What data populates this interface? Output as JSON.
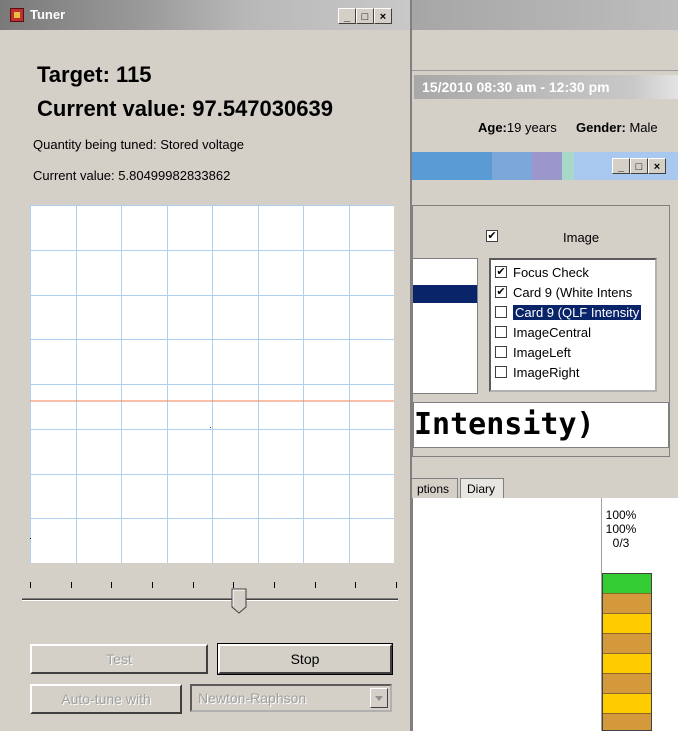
{
  "tuner": {
    "title": "Tuner",
    "target": "Target: 115",
    "current_value_large": "Current value: 97.547030639",
    "quantity": "Quantity being tuned: Stored voltage",
    "current_value_small": "Current value: 5.80499982833862",
    "buttons": {
      "test": "Test",
      "stop": "Stop",
      "autotune": "Auto-tune with"
    },
    "method_select": {
      "value": "Newton-Raphson"
    },
    "slider": {
      "ticks": 10,
      "position_fraction": 0.58
    },
    "plot": {
      "target_line_color": "#f08050",
      "grid_color": "#b0d0f0"
    }
  },
  "background_app": {
    "date_range": "15/2010 08:30 am - 12:30 pm",
    "age_label": "Age:",
    "age_value": "19 years",
    "gender_label": "Gender:",
    "gender_value": "Male",
    "image_checkbox_label": "Image",
    "checklist": [
      {
        "label": "Focus Check",
        "checked": true
      },
      {
        "label": "Card 9 (White Intens",
        "checked": true
      },
      {
        "label": "Card 9 (QLF Intensity",
        "checked": false,
        "selected": true
      },
      {
        "label": "ImageCentral",
        "checked": false
      },
      {
        "label": "ImageLeft",
        "checked": false
      },
      {
        "label": "ImageRight",
        "checked": false
      }
    ],
    "big_title": "Intensity)",
    "tabs": [
      "ptions",
      "Diary"
    ],
    "gauge": {
      "line1": "100%",
      "line2": "100%",
      "line3": "0/3"
    }
  }
}
